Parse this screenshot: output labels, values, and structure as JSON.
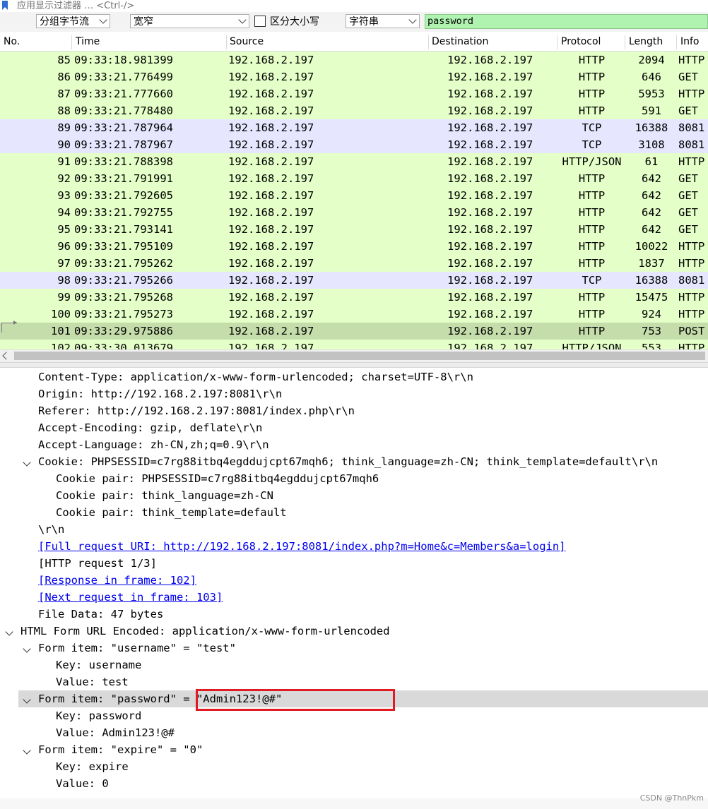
{
  "filter_bar": {
    "placeholder": "应用显示过滤器 … <Ctrl-/>"
  },
  "toolbar": {
    "search_in": "分组字节流",
    "char_width": "宽窄",
    "case_label": "区分大小写",
    "search_type": "字符串",
    "search_text": "password"
  },
  "packet_list": {
    "columns": [
      "No.",
      "Time",
      "Source",
      "Destination",
      "Protocol",
      "Length",
      "Info"
    ],
    "rows": [
      {
        "no": "85",
        "time": "09:33:18.981399",
        "src": "192.168.2.197",
        "dst": "192.168.2.197",
        "proto": "HTTP",
        "len": "2094",
        "info": "HTTP",
        "color": "#e4ffc7"
      },
      {
        "no": "86",
        "time": "09:33:21.776499",
        "src": "192.168.2.197",
        "dst": "192.168.2.197",
        "proto": "HTTP",
        "len": "646",
        "info": "GET",
        "color": "#e4ffc7"
      },
      {
        "no": "87",
        "time": "09:33:21.777660",
        "src": "192.168.2.197",
        "dst": "192.168.2.197",
        "proto": "HTTP",
        "len": "5953",
        "info": "HTTP",
        "color": "#e4ffc7"
      },
      {
        "no": "88",
        "time": "09:33:21.778480",
        "src": "192.168.2.197",
        "dst": "192.168.2.197",
        "proto": "HTTP",
        "len": "591",
        "info": "GET",
        "color": "#e4ffc7"
      },
      {
        "no": "89",
        "time": "09:33:21.787964",
        "src": "192.168.2.197",
        "dst": "192.168.2.197",
        "proto": "TCP",
        "len": "16388",
        "info": "8081",
        "color": "#e7e6ff"
      },
      {
        "no": "90",
        "time": "09:33:21.787967",
        "src": "192.168.2.197",
        "dst": "192.168.2.197",
        "proto": "TCP",
        "len": "3108",
        "info": "8081",
        "color": "#e7e6ff"
      },
      {
        "no": "91",
        "time": "09:33:21.788398",
        "src": "192.168.2.197",
        "dst": "192.168.2.197",
        "proto": "HTTP/JSON",
        "len": "61",
        "info": "HTTP",
        "color": "#e4ffc7"
      },
      {
        "no": "92",
        "time": "09:33:21.791991",
        "src": "192.168.2.197",
        "dst": "192.168.2.197",
        "proto": "HTTP",
        "len": "642",
        "info": "GET",
        "color": "#e4ffc7"
      },
      {
        "no": "93",
        "time": "09:33:21.792605",
        "src": "192.168.2.197",
        "dst": "192.168.2.197",
        "proto": "HTTP",
        "len": "642",
        "info": "GET",
        "color": "#e4ffc7"
      },
      {
        "no": "94",
        "time": "09:33:21.792755",
        "src": "192.168.2.197",
        "dst": "192.168.2.197",
        "proto": "HTTP",
        "len": "642",
        "info": "GET",
        "color": "#e4ffc7"
      },
      {
        "no": "95",
        "time": "09:33:21.793141",
        "src": "192.168.2.197",
        "dst": "192.168.2.197",
        "proto": "HTTP",
        "len": "642",
        "info": "GET",
        "color": "#e4ffc7"
      },
      {
        "no": "96",
        "time": "09:33:21.795109",
        "src": "192.168.2.197",
        "dst": "192.168.2.197",
        "proto": "HTTP",
        "len": "10022",
        "info": "HTTP",
        "color": "#e4ffc7"
      },
      {
        "no": "97",
        "time": "09:33:21.795262",
        "src": "192.168.2.197",
        "dst": "192.168.2.197",
        "proto": "HTTP",
        "len": "1837",
        "info": "HTTP",
        "color": "#e4ffc7"
      },
      {
        "no": "98",
        "time": "09:33:21.795266",
        "src": "192.168.2.197",
        "dst": "192.168.2.197",
        "proto": "TCP",
        "len": "16388",
        "info": "8081",
        "color": "#e7e6ff"
      },
      {
        "no": "99",
        "time": "09:33:21.795268",
        "src": "192.168.2.197",
        "dst": "192.168.2.197",
        "proto": "HTTP",
        "len": "15475",
        "info": "HTTP",
        "color": "#e4ffc7"
      },
      {
        "no": "100",
        "time": "09:33:21.795273",
        "src": "192.168.2.197",
        "dst": "192.168.2.197",
        "proto": "HTTP",
        "len": "924",
        "info": "HTTP",
        "color": "#e4ffc7"
      },
      {
        "no": "101",
        "time": "09:33:29.975886",
        "src": "192.168.2.197",
        "dst": "192.168.2.197",
        "proto": "HTTP",
        "len": "753",
        "info": "POST",
        "color": "#c5dcab",
        "selected": true
      },
      {
        "no": "102",
        "time": "09:33:30.013679",
        "src": "192.168.2.197",
        "dst": "192.168.2.197",
        "proto": "HTTP/JSON",
        "len": "553",
        "info": "HTTP",
        "color": "#e4ffc7"
      }
    ]
  },
  "details": {
    "lines": [
      {
        "text": "Content-Type: application/x-www-form-urlencoded; charset=UTF-8\\r\\n",
        "indent": 1
      },
      {
        "text": "Origin: http://192.168.2.197:8081\\r\\n",
        "indent": 1
      },
      {
        "text": "Referer: http://192.168.2.197:8081/index.php\\r\\n",
        "indent": 1
      },
      {
        "text": "Accept-Encoding: gzip, deflate\\r\\n",
        "indent": 1
      },
      {
        "text": "Accept-Language: zh-CN,zh;q=0.9\\r\\n",
        "indent": 1
      },
      {
        "text": "Cookie: PHPSESSID=c7rg88itbq4egddujcpt67mqh6; think_language=zh-CN; think_template=default\\r\\n",
        "indent": 1,
        "expanded": true
      },
      {
        "text": "Cookie pair: PHPSESSID=c7rg88itbq4egddujcpt67mqh6",
        "indent": 2
      },
      {
        "text": "Cookie pair: think_language=zh-CN",
        "indent": 2
      },
      {
        "text": "Cookie pair: think_template=default",
        "indent": 2
      },
      {
        "text": "\\r\\n",
        "indent": 1
      },
      {
        "text": "[Full request URI: http://192.168.2.197:8081/index.php?m=Home&c=Members&a=login]",
        "indent": 1,
        "link": true
      },
      {
        "text": "[HTTP request 1/3]",
        "indent": 1
      },
      {
        "text": "[Response in frame: 102]",
        "indent": 1,
        "link": true
      },
      {
        "text": "[Next request in frame: 103]",
        "indent": 1,
        "link": true
      },
      {
        "text": "File Data: 47 bytes",
        "indent": 1
      },
      {
        "text": "HTML Form URL Encoded: application/x-www-form-urlencoded",
        "indent": 0,
        "expanded": true
      },
      {
        "text": "Form item: \"username\" = \"test\"",
        "indent": 1,
        "expanded": true
      },
      {
        "text": "Key: username",
        "indent": 2
      },
      {
        "text": "Value: test",
        "indent": 2
      },
      {
        "text": "Form item: \"password\" = \"Admin123!@#\"",
        "indent": 1,
        "expanded": true,
        "highlight": true
      },
      {
        "text": "Key: password",
        "indent": 2
      },
      {
        "text": "Value: Admin123!@#",
        "indent": 2
      },
      {
        "text": "Form item: \"expire\" = \"0\"",
        "indent": 1,
        "expanded": true
      },
      {
        "text": "Key: expire",
        "indent": 2
      },
      {
        "text": "Value: 0",
        "indent": 2
      }
    ]
  },
  "watermark": "CSDN @ThnPkm",
  "colors": {
    "http_row": "#e4ffc7",
    "tcp_row": "#e7e6ff",
    "selected_row": "#c5dcab",
    "search_field": "#b0f2b0",
    "annotation_box": "#e01b24"
  }
}
